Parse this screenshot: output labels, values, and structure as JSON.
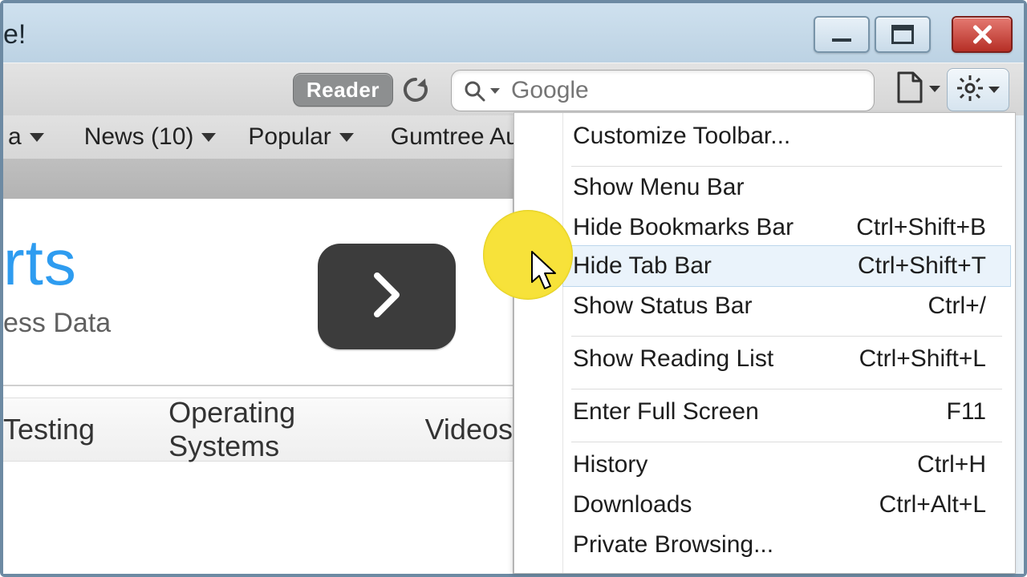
{
  "window": {
    "title_fragment": "e!"
  },
  "toolbar": {
    "reader_label": "Reader",
    "search_placeholder": "Google"
  },
  "bookmarks": {
    "item0_fragment": "a",
    "item1": "News (10)",
    "item2": "Popular",
    "item3": "Gumtree Au...ssifieds."
  },
  "content": {
    "brand_fragment": "rts",
    "tagline_fragment": "ess Data",
    "nav1": "Testing",
    "nav2": "Operating Systems",
    "nav3": "Videos"
  },
  "menu": {
    "customize": "Customize Toolbar...",
    "show_menu": "Show Menu Bar",
    "hide_bookmarks": "Hide Bookmarks Bar",
    "hide_bookmarks_cut": "Ctrl+Shift+B",
    "hide_tab": "Hide Tab Bar",
    "hide_tab_cut": "Ctrl+Shift+T",
    "show_status": "Show Status Bar",
    "show_status_cut": "Ctrl+/",
    "reading_list": "Show Reading List",
    "reading_list_cut": "Ctrl+Shift+L",
    "fullscreen": "Enter Full Screen",
    "fullscreen_cut": "F11",
    "history": "History",
    "history_cut": "Ctrl+H",
    "downloads": "Downloads",
    "downloads_cut": "Ctrl+Alt+L",
    "private": "Private Browsing..."
  }
}
